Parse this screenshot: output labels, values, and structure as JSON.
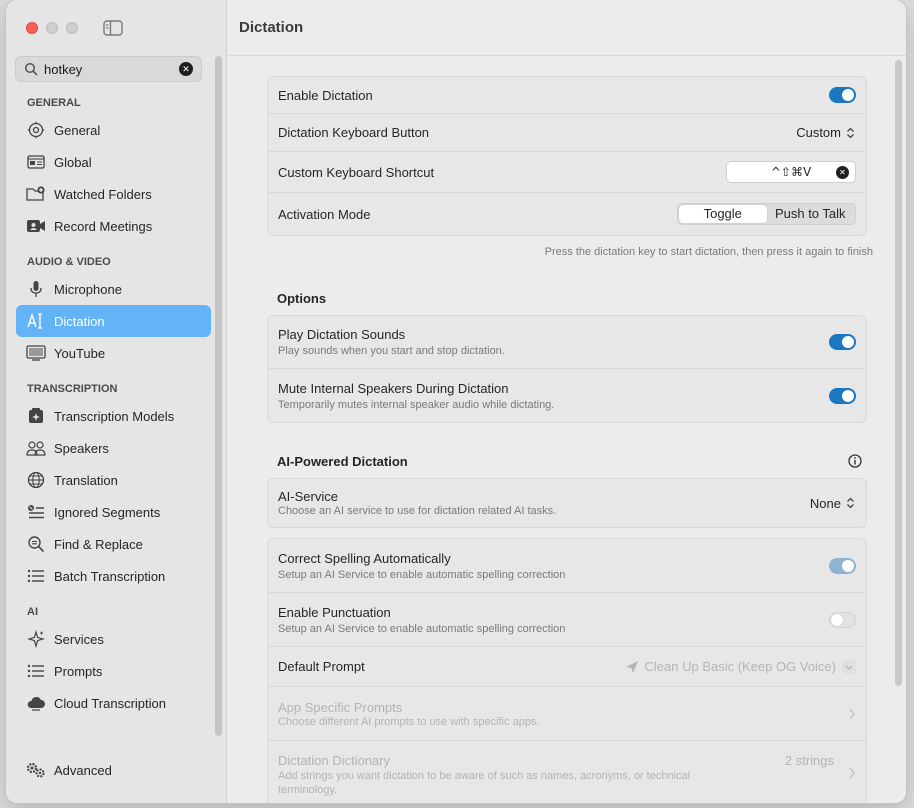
{
  "window": {
    "title": "Dictation"
  },
  "search": {
    "value": "hotkey",
    "clear_label": "✕"
  },
  "sidebar": {
    "sections": [
      {
        "title": "GENERAL",
        "items": [
          {
            "label": "General",
            "icon": "gear-icon"
          },
          {
            "label": "Global",
            "icon": "keyboard-icon"
          },
          {
            "label": "Watched Folders",
            "icon": "folder-plus-icon"
          },
          {
            "label": "Record Meetings",
            "icon": "video-person-icon"
          }
        ]
      },
      {
        "title": "AUDIO & VIDEO",
        "items": [
          {
            "label": "Microphone",
            "icon": "microphone-icon"
          },
          {
            "label": "Dictation",
            "icon": "ai-cursor-icon",
            "active": true
          },
          {
            "label": "YouTube",
            "icon": "display-icon"
          }
        ]
      },
      {
        "title": "TRANSCRIPTION",
        "items": [
          {
            "label": "Transcription Models",
            "icon": "model-sparkle-icon"
          },
          {
            "label": "Speakers",
            "icon": "people-icon"
          },
          {
            "label": "Translation",
            "icon": "globe-icon"
          },
          {
            "label": "Ignored Segments",
            "icon": "ignore-list-icon"
          },
          {
            "label": "Find & Replace",
            "icon": "find-replace-icon"
          },
          {
            "label": "Batch Transcription",
            "icon": "batch-list-icon"
          }
        ]
      },
      {
        "title": "AI",
        "items": [
          {
            "label": "Services",
            "icon": "sparkles-icon"
          },
          {
            "label": "Prompts",
            "icon": "list-icon"
          },
          {
            "label": "Cloud Transcription",
            "icon": "cloud-icon"
          }
        ]
      }
    ],
    "footer": {
      "label": "Advanced",
      "icon": "gears-icon"
    }
  },
  "dictation": {
    "enable": {
      "label": "Enable Dictation",
      "on": true
    },
    "keyboard_button": {
      "label": "Dictation Keyboard Button",
      "value": "Custom"
    },
    "custom_shortcut": {
      "label": "Custom Keyboard Shortcut",
      "value": "^⇧⌘V"
    },
    "activation_mode": {
      "label": "Activation Mode",
      "options": [
        "Toggle",
        "Push to Talk"
      ],
      "selected": "Toggle"
    },
    "hint": "Press the dictation key to start dictation, then press it again to finish"
  },
  "options": {
    "title": "Options",
    "play_sounds": {
      "label": "Play Dictation Sounds",
      "sub": "Play sounds when you start and stop dictation.",
      "on": true
    },
    "mute_speakers": {
      "label": "Mute Internal Speakers During Dictation",
      "sub": "Temporarily mutes internal speaker audio while dictating.",
      "on": true
    }
  },
  "ai": {
    "title": "AI-Powered Dictation",
    "service": {
      "label": "AI-Service",
      "sub": "Choose an AI service to use for dictation related AI tasks.",
      "value": "None"
    },
    "correct_spelling": {
      "label": "Correct Spelling Automatically",
      "sub": "Setup an AI Service to enable automatic spelling correction",
      "on": true
    },
    "punctuation": {
      "label": "Enable Punctuation",
      "sub": "Setup an AI Service to enable automatic spelling correction",
      "on": false
    },
    "default_prompt": {
      "label": "Default Prompt",
      "value": "Clean Up Basic (Keep OG Voice)"
    },
    "app_prompts": {
      "label": "App Specific Prompts",
      "sub": "Choose different AI prompts to use with specific apps."
    },
    "dictionary": {
      "label": "Dictation Dictionary",
      "sub": "Add strings you want dictation to be aware of such as names, acronyms, or technical terminology.",
      "count": "2 strings"
    }
  },
  "colors": {
    "accent": "#1b77bf",
    "sidebar_active": "#63b3f7",
    "close": "#fe5f57"
  }
}
